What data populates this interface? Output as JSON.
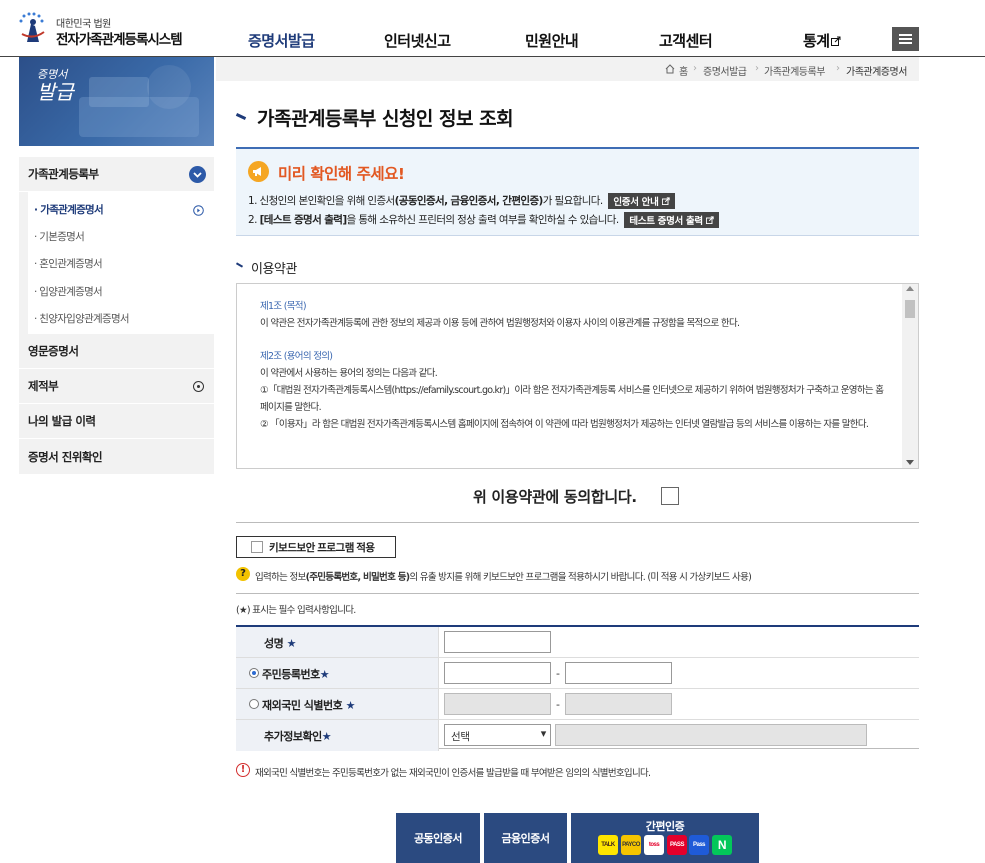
{
  "header": {
    "logo_sub": "대한민국 법원",
    "logo_main": "전자가족관계등록시스템",
    "nav": [
      "증명서발급",
      "인터넷신고",
      "민원안내",
      "고객센터",
      "통계"
    ]
  },
  "sidebar": {
    "banner_line1": "증명서",
    "banner_line2": "발급",
    "groups": [
      "가족관계등록부",
      "영문증명서",
      "제적부",
      "나의 발급 이력",
      "증명서 진위확인"
    ],
    "sub_items": [
      "· 가족관계증명서",
      "· 기본증명서",
      "· 혼인관계증명서",
      "· 입양관계증명서",
      "· 친양자입양관계증명서"
    ]
  },
  "breadcrumb": [
    "홈",
    "증명서발급",
    "가족관계등록부",
    "가족관계증명서"
  ],
  "page_title": "가족관계등록부 신청인 정보 조회",
  "notice": {
    "title": "미리 확인해 주세요!",
    "line1_a": "1. 신청인의 본인확인을 위해 인증서",
    "line1_b": "(공동인증서, 금융인증서, 간편인증)",
    "line1_c": "가 필요합니다.",
    "line1_btn": "인증서 안내",
    "line2_a": "2. ",
    "line2_b": "[테스트 증명서 출력]",
    "line2_c": "을 통해 소유하신 프린터의 정상 출력 여부를 확인하실 수 있습니다.",
    "line2_btn": "테스트 증명서 출력"
  },
  "terms": {
    "heading": "이용약관",
    "art1_title": "제1조 (목적)",
    "art1_body": "이 약관은 전자가족관계등록에 관한 정보의 제공과 이용 등에 관하여 법원행정처와 이용자 사이의 이용관계를 규정함을 목적으로 한다.",
    "art2_title": "제2조 (용어의 정의)",
    "art2_body": "이 약관에서 사용하는 용어의 정의는 다음과 같다.",
    "art2_item1": "①「대법원 전자가족관계등록시스템(https://efamily.scourt.go.kr)」이라 함은 전자가족관계등록 서비스를 인터넷으로 제공하기 위하여 법원행정처가 구축하고 운영하는 홈페이지를 말한다.",
    "art2_item2": "② 「이용자」라 함은 대법원 전자가족관계등록시스템 홈페이지에 접속하여 이 약관에 따라 법원행정처가 제공하는 인터넷 열람발급 등의 서비스를 이용하는 자를 말한다."
  },
  "agree_text": "위 이용약관에 동의합니다.",
  "keyboard": {
    "button": "키보드보안 프로그램 적용",
    "info_a": "입력하는 정보",
    "info_b": "(주민등록번호, 비밀번호 등)",
    "info_c": "의 유출 방지를 위해 키보드보안 프로그램을 적용하시기 바랍니다. (미 적용 시 가상키보드 사용)"
  },
  "required_note": "(★) 표시는 필수 입력사항입니다.",
  "form": {
    "name_label": "성명",
    "rrn_label": "주민등록번호",
    "foreign_label": "재외국민 식별번호",
    "extra_label": "추가정보확인",
    "star": "★",
    "dash": "-",
    "select_value": "선택"
  },
  "foreign_note": "재외국민 식별번호는 주민등록번호가 없는 재외국민이 인증서를 발급받을 때 부여받은 임의의 식별번호입니다.",
  "cert_buttons": {
    "joint": "공동인증서",
    "financial": "금융인증서",
    "simple": "간편인증",
    "providers": [
      "TALK",
      "PAYCO",
      "toss",
      "PASS",
      "Pass",
      "N"
    ]
  },
  "colors": {
    "primary": "#1e3b7a",
    "accent": "#e25822",
    "button": "#2b4a80"
  }
}
